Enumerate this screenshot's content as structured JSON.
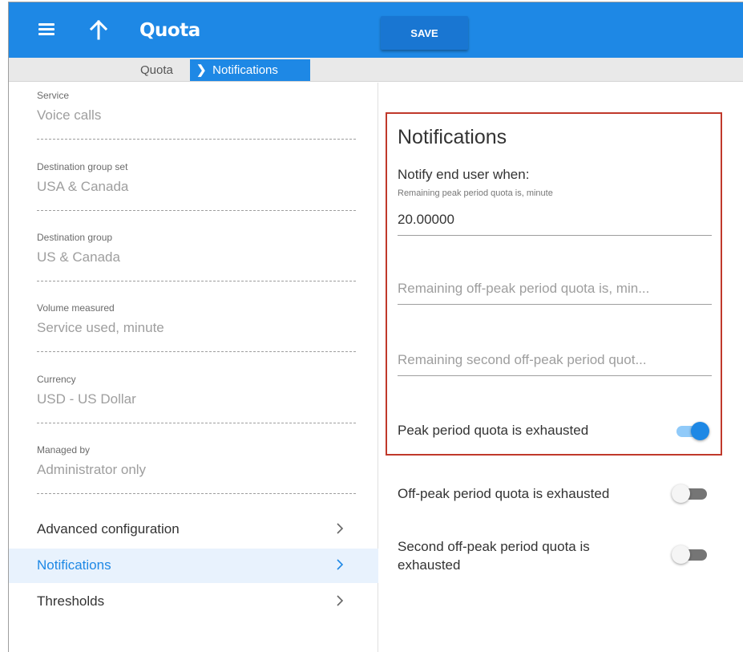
{
  "header": {
    "title": "Quota",
    "save_label": "SAVE",
    "menu_icon": "hamburger-menu-icon",
    "back_icon": "arrow-up-icon",
    "bar_color": "#1e88e5"
  },
  "breadcrumb": {
    "items": [
      "Quota",
      "Notifications"
    ]
  },
  "details": {
    "fields": [
      {
        "label": "Service",
        "value": "Voice calls"
      },
      {
        "label": "Destination group set",
        "value": "USA & Canada"
      },
      {
        "label": "Destination group",
        "value": "US & Canada"
      },
      {
        "label": "Volume measured",
        "value": "Service used, minute"
      },
      {
        "label": "Currency",
        "value": "USD - US Dollar"
      },
      {
        "label": "Managed by",
        "value": "Administrator only"
      }
    ]
  },
  "nav": {
    "items": [
      {
        "label": "Advanced configuration",
        "active": false
      },
      {
        "label": "Notifications",
        "active": true
      },
      {
        "label": "Thresholds",
        "active": false
      }
    ]
  },
  "notifications": {
    "title": "Notifications",
    "notify_label": "Notify end user when:",
    "peak_input": {
      "label": "Remaining peak period quota is, minute",
      "value": "20.00000"
    },
    "offpeak_input": {
      "placeholder": "Remaining off-peak period quota is, min..."
    },
    "second_offpeak_input": {
      "placeholder": "Remaining second off-peak period quot..."
    },
    "toggles": [
      {
        "label": "Peak period quota is exhausted",
        "on": true
      },
      {
        "label": "Off-peak period quota is exhausted",
        "on": false
      },
      {
        "label_line1": "Second off-peak period quota is",
        "label_line2": "exhausted",
        "on": false
      }
    ],
    "highlight_color": "#c0392b"
  }
}
